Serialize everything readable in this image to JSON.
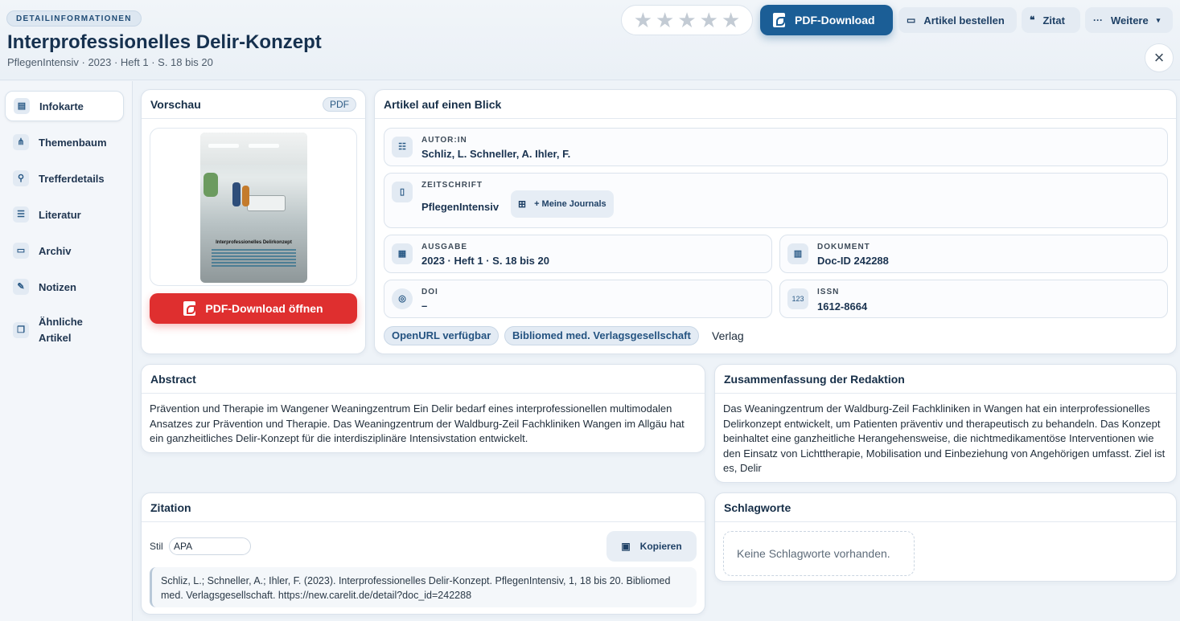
{
  "header": {
    "badge": "DETAILINFORMATIONEN",
    "title": "Interprofessionelles Delir-Konzept",
    "subtitle": "PflegenIntensiv · 2023 · Heft 1 · S. 18 bis 20",
    "rating": {
      "value": 0,
      "max": 5
    },
    "pdf_download": "PDF-Download",
    "order_article": "Artikel bestellen",
    "citation": "Zitat",
    "more": "Weitere",
    "close": "×"
  },
  "sidebar": {
    "items": [
      {
        "label": "Infokarte",
        "icon": "info-card-icon",
        "active": true
      },
      {
        "label": "Themenbaum",
        "icon": "tree-icon"
      },
      {
        "label": "Trefferdetails",
        "icon": "search-icon"
      },
      {
        "label": "Literatur",
        "icon": "list-icon"
      },
      {
        "label": "Archiv",
        "icon": "archive-icon"
      },
      {
        "label": "Notizen",
        "icon": "notes-icon"
      },
      {
        "label": "Ähnliche Artikel",
        "icon": "similar-icon"
      }
    ]
  },
  "preview": {
    "title": "Vorschau",
    "tag": "PDF",
    "cover_title": "Interprofessionelles Delirkonzept",
    "open_pdf": "PDF-Download öffnen"
  },
  "overview": {
    "title": "Artikel auf einen Blick",
    "author_label": "AUTOR:IN",
    "author_value": "Schliz, L. Schneller, A. Ihler, F.",
    "journal_label": "ZEITSCHRIFT",
    "journal_value": "PflegenIntensiv",
    "my_journals": "+ Meine Journals",
    "issue_label": "AUSGABE",
    "issue_value": "2023 · Heft 1 · S. 18 bis 20",
    "doc_label": "DOKUMENT",
    "doc_value": "Doc-ID 242288",
    "doi_label": "DOI",
    "doi_value": "–",
    "issn_label": "ISSN",
    "issn_value": "1612-8664",
    "issn_icon_text": "123",
    "openurl": "OpenURL verfügbar",
    "publisher": "Bibliomed med. Verlagsgesellschaft",
    "publisher_suffix": "Verlag"
  },
  "abstract": {
    "title": "Abstract",
    "text": "Prävention und Therapie im Wangener Weaningzentrum Ein Delir bedarf eines interprofessionellen multimodalen Ansatzes zur Prävention und Therapie. Das Weaningzentrum der Waldburg-Zeil Fachkliniken Wangen im Allgäu hat ein ganzheitliches Delir-Konzept für die interdisziplinäre Intensivstation entwickelt."
  },
  "summary": {
    "title": "Zusammenfassung der Redaktion",
    "text": "Das Weaningzentrum der Waldburg-Zeil Fachkliniken in Wangen hat ein interprofessionelles Delirkonzept entwickelt, um Patienten präventiv und therapeutisch zu behandeln. Das Konzept beinhaltet eine ganzheitliche Herangehensweise, die nichtmedikamentöse Interventionen wie den Einsatz von Lichttherapie, Mobilisation und Einbeziehung von Angehörigen umfasst. Ziel ist es, Delir"
  },
  "citation": {
    "title": "Zitation",
    "style_label": "Stil",
    "style_value": "APA",
    "copy": "Kopieren",
    "text": "Schliz, L.; Schneller, A.; Ihler, F. (2023). Interprofessionelles Delir-Konzept. PflegenIntensiv, 1, 18 bis 20. Bibliomed med. Verlagsgesellschaft. https://new.carelit.de/detail?doc_id=242288"
  },
  "keywords": {
    "title": "Schlagworte",
    "empty": "Keine Schlagworte vorhanden."
  },
  "colors": {
    "primary": "#1b5e96",
    "danger": "#df2f2f",
    "background": "#eef3f8"
  }
}
